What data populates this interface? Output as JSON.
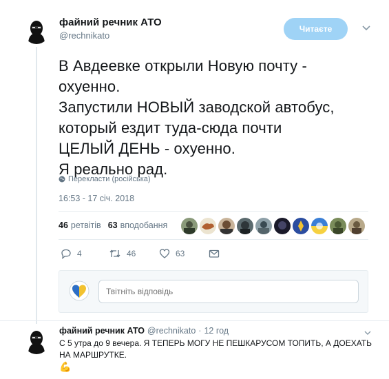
{
  "tweet": {
    "author_name": "файний речник АТО",
    "author_handle": "@rechnikato",
    "follow_label": "Читаєте",
    "text_lines": [
      "В Авдеевке открыли Новую почту -",
      "охуенно.",
      "Запустили НОВЫЙ заводской автобус,",
      "который ездит туда-сюда почти",
      "ЦЕЛЫЙ ДЕНЬ - охуенно.",
      "Я реально рад."
    ],
    "translate_label": "Перекласти (російська)",
    "timestamp": "16:53 - 17 січ. 2018",
    "retweets_count": "46",
    "retweets_label": "ретвітів",
    "likes_count": "63",
    "likes_label": "вподобання",
    "actions": {
      "reply_count": "4",
      "retweet_count": "46",
      "like_count": "63"
    }
  },
  "reply_composer": {
    "placeholder": "Твітніть відповідь"
  },
  "reply_tweet": {
    "author_name": "файний речник АТО",
    "author_handle": "@rechnikato",
    "separator": "·",
    "time": "12 год",
    "text": "С 5 утра до 9 вечера. Я ТЕПЕРЬ МОГУ НЕ ПЕШКАРУСОМ ТОПИТЬ, А ДОЕХАТЬ НА МАРШРУТКЕ.",
    "emoji": "💪"
  },
  "colors": {
    "accent": "#9fd3f6",
    "text_primary": "#14171a",
    "text_secondary": "#657786",
    "divider": "#e6ecf0"
  },
  "icons": [
    "chevron-down-icon",
    "globe-icon",
    "reply-icon",
    "retweet-icon",
    "heart-icon",
    "message-icon"
  ]
}
